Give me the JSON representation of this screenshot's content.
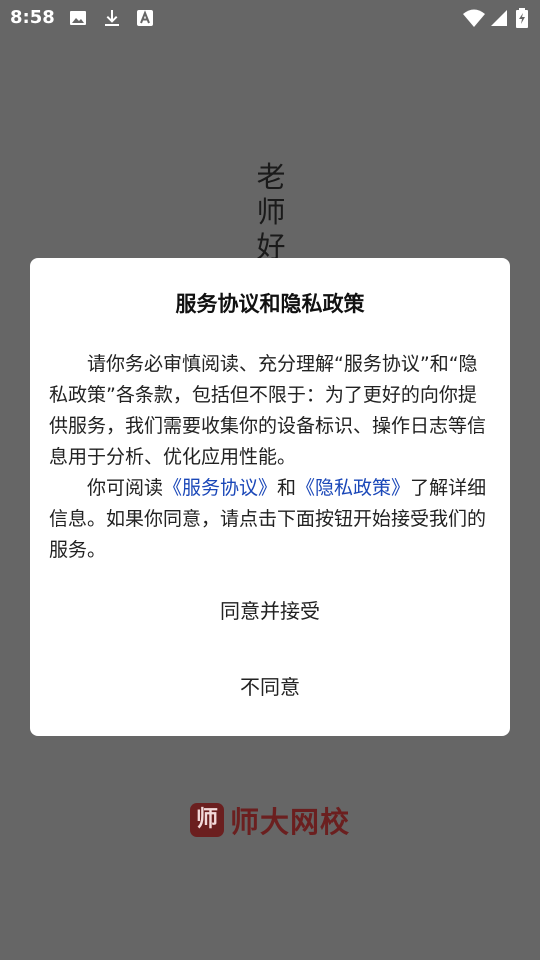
{
  "status_bar": {
    "time": "8:58",
    "left_icons": [
      "image-icon",
      "download-icon",
      "font-a-icon"
    ],
    "right_icons": [
      "wifi-icon",
      "signal-icon",
      "battery-icon"
    ]
  },
  "background": {
    "vertical_title": [
      "老",
      "师",
      "好"
    ],
    "brand_mark": "师",
    "brand_name": "师大网校",
    "brand_color": "#6b1f1f"
  },
  "dialog": {
    "title": "服务协议和隐私政策",
    "para1": "请你务必审慎阅读、充分理解“服务协议”和“隐私政策”各条款，包括但不限于：为了更好的向你提供服务，我们需要收集你的设备标识、操作日志等信息用于分析、优化应用性能。",
    "para2_prefix": "你可阅读",
    "link_service": "《服务协议》",
    "para2_and": "和",
    "link_privacy": "《隐私政策》",
    "para2_suffix": "了解详细信息。如果你同意，请点击下面按钮开始接受我们的服务。",
    "agree_label": "同意并接受",
    "disagree_label": "不同意",
    "link_color": "#1a47b8"
  }
}
